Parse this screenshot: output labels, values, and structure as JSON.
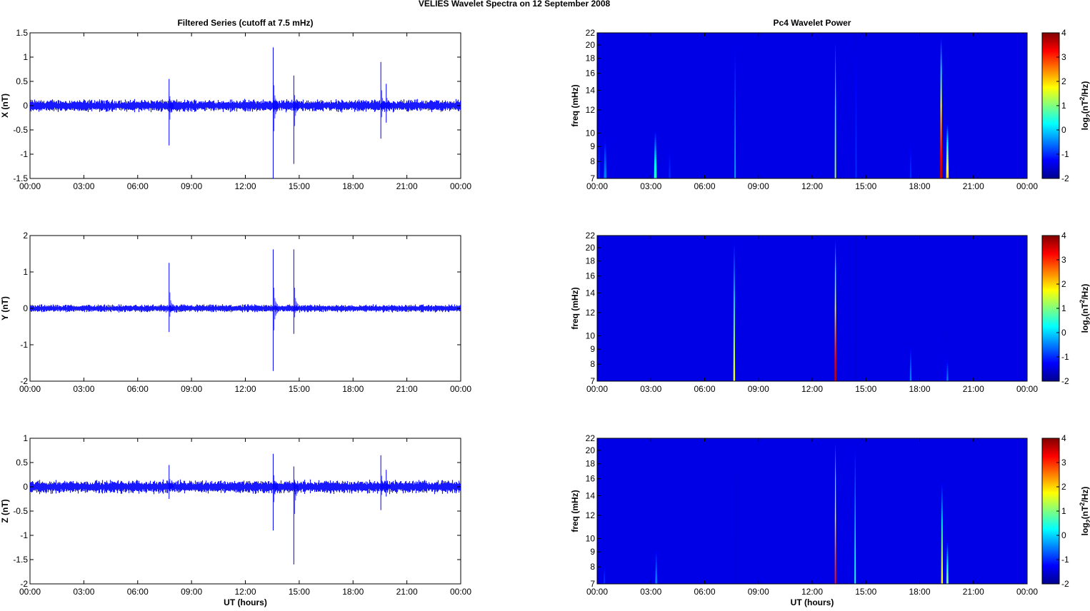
{
  "figure_title": "VELIES Wavelet Spectra on 12 September 2008",
  "chart_data": [
    {
      "type": "line",
      "title": "Filtered Series (cutoff at 7.5 mHz)",
      "ylabel": "X (nT)",
      "xlabel": "",
      "xlim": [
        0,
        24
      ],
      "xticks": [
        "00:00",
        "03:00",
        "06:00",
        "09:00",
        "12:00",
        "15:00",
        "18:00",
        "21:00",
        "00:00"
      ],
      "ylim": [
        -1.5,
        1.5
      ],
      "yticks": [
        "-1.5",
        "-1",
        "-0.5",
        "0",
        "0.5",
        "1",
        "1.5"
      ],
      "noise_amplitude": 0.12,
      "spikes": [
        {
          "t": 7.75,
          "max": 0.55,
          "min": -0.82
        },
        {
          "t": 13.55,
          "max": 1.2,
          "min": -1.5
        },
        {
          "t": 14.7,
          "max": 0.62,
          "min": -1.2
        },
        {
          "t": 19.55,
          "max": 0.9,
          "min": -0.68
        },
        {
          "t": 19.85,
          "max": 0.45,
          "min": -0.35
        }
      ],
      "color": "#0000ff"
    },
    {
      "type": "line",
      "title": "",
      "ylabel": "Y (nT)",
      "xlabel": "",
      "xlim": [
        0,
        24
      ],
      "xticks": [
        "00:00",
        "03:00",
        "06:00",
        "09:00",
        "12:00",
        "15:00",
        "18:00",
        "21:00",
        "00:00"
      ],
      "ylim": [
        -2,
        2
      ],
      "yticks": [
        "-2",
        "-1",
        "0",
        "1",
        "2"
      ],
      "noise_amplitude": 0.1,
      "spikes": [
        {
          "t": 7.75,
          "max": 1.25,
          "min": -0.65
        },
        {
          "t": 13.55,
          "max": 1.62,
          "min": -1.72
        },
        {
          "t": 14.7,
          "max": 1.62,
          "min": -0.7
        }
      ],
      "color": "#0000ff"
    },
    {
      "type": "line",
      "title": "",
      "ylabel": "Z (nT)",
      "xlabel": "UT (hours)",
      "xlim": [
        0,
        24
      ],
      "xticks": [
        "00:00",
        "03:00",
        "06:00",
        "09:00",
        "12:00",
        "15:00",
        "18:00",
        "21:00",
        "00:00"
      ],
      "ylim": [
        -2,
        1
      ],
      "yticks": [
        "-2",
        "-1.5",
        "-1",
        "-0.5",
        "0",
        "0.5",
        "1"
      ],
      "noise_amplitude": 0.13,
      "spikes": [
        {
          "t": 7.75,
          "max": 0.45,
          "min": -0.25
        },
        {
          "t": 13.55,
          "max": 0.68,
          "min": -0.9
        },
        {
          "t": 14.7,
          "max": 0.42,
          "min": -1.6
        },
        {
          "t": 19.55,
          "max": 0.65,
          "min": -0.48
        },
        {
          "t": 19.85,
          "max": 0.35,
          "min": -0.2
        }
      ],
      "color": "#0000ff"
    },
    {
      "type": "heatmap",
      "title": "Pc4 Wavelet Power",
      "ylabel": "freq (mHz)",
      "xlabel": "",
      "xlim": [
        0,
        24
      ],
      "xticks": [
        "00:00",
        "03:00",
        "06:00",
        "09:00",
        "12:00",
        "15:00",
        "18:00",
        "21:00",
        "00:00"
      ],
      "ylim": [
        7,
        22
      ],
      "yscale": "log",
      "yticks": [
        "7",
        "8",
        "9",
        "10",
        "12",
        "14",
        "16",
        "18",
        "20",
        "22"
      ],
      "colorbar": {
        "label": "log2(nT^2/Hz)",
        "label_main": "log",
        "label_sub": "2",
        "label_rest": "(nT",
        "label_sup": "2",
        "label_end": "/Hz)",
        "range": [
          -2,
          4
        ],
        "ticks": [
          "-2",
          "-1",
          "0",
          "1",
          "2",
          "3",
          "4"
        ],
        "colormap": "jet"
      },
      "events": [
        {
          "t": 0.1,
          "fmax": 11.5,
          "power": -1,
          "width": 0.12
        },
        {
          "t": 0.45,
          "fmax": 10,
          "power": -0.5,
          "width": 0.15
        },
        {
          "t": 3.25,
          "fmax": 10.5,
          "power": 0.5,
          "width": 0.15
        },
        {
          "t": 4.05,
          "fmax": 9.5,
          "power": -1,
          "width": 0.1
        },
        {
          "t": 7.7,
          "fmax": 22,
          "power": -0.3,
          "width": 0.06
        },
        {
          "t": 13.3,
          "fmax": 22,
          "power": 1.2,
          "width": 0.07
        },
        {
          "t": 14.45,
          "fmax": 22,
          "power": -1,
          "width": 0.06
        },
        {
          "t": 17.5,
          "fmax": 10,
          "power": -1,
          "width": 0.1
        },
        {
          "t": 19.2,
          "fmax": 22,
          "power": 3.6,
          "width": 0.12
        },
        {
          "t": 19.55,
          "fmax": 11,
          "power": 2,
          "width": 0.15
        }
      ]
    },
    {
      "type": "heatmap",
      "title": "",
      "ylabel": "freq (mHz)",
      "xlabel": "",
      "xlim": [
        0,
        24
      ],
      "xticks": [
        "00:00",
        "03:00",
        "06:00",
        "09:00",
        "12:00",
        "15:00",
        "18:00",
        "21:00",
        "00:00"
      ],
      "ylim": [
        7,
        22
      ],
      "yscale": "log",
      "yticks": [
        "7",
        "8",
        "9",
        "10",
        "12",
        "14",
        "16",
        "18",
        "20",
        "22"
      ],
      "colorbar": {
        "label": "log2(nT^2/Hz)",
        "label_main": "log",
        "label_sub": "2",
        "label_rest": "(nT",
        "label_sup": "2",
        "label_end": "/Hz)",
        "range": [
          -2,
          4
        ],
        "ticks": [
          "-2",
          "-1",
          "0",
          "1",
          "2",
          "3",
          "4"
        ],
        "colormap": "jet"
      },
      "events": [
        {
          "t": 7.65,
          "fmax": 22,
          "power": 1.6,
          "width": 0.1
        },
        {
          "t": 13.3,
          "fmax": 22,
          "power": 3.6,
          "width": 0.1
        },
        {
          "t": 14.45,
          "fmax": 22,
          "power": -1.5,
          "width": 0.05
        },
        {
          "t": 17.5,
          "fmax": 9.5,
          "power": -0.5,
          "width": 0.1
        },
        {
          "t": 19.4,
          "fmax": 10.5,
          "power": -1.3,
          "width": 0.08
        },
        {
          "t": 19.55,
          "fmax": 8.5,
          "power": -0.5,
          "width": 0.1
        }
      ]
    },
    {
      "type": "heatmap",
      "title": "",
      "ylabel": "freq (mHz)",
      "xlabel": "UT (hours)",
      "xlim": [
        0,
        24
      ],
      "xticks": [
        "00:00",
        "03:00",
        "06:00",
        "09:00",
        "12:00",
        "15:00",
        "18:00",
        "21:00",
        "00:00"
      ],
      "ylim": [
        7,
        22
      ],
      "yscale": "log",
      "yticks": [
        "7",
        "8",
        "9",
        "10",
        "12",
        "14",
        "16",
        "18",
        "20",
        "22"
      ],
      "colorbar": {
        "label": "log2(nT^2/Hz)",
        "label_main": "log",
        "label_sub": "2",
        "label_rest": "(nT",
        "label_sup": "2",
        "label_end": "/Hz)",
        "range": [
          -2,
          4
        ],
        "ticks": [
          "-2",
          "-1",
          "0",
          "1",
          "2",
          "3",
          "4"
        ],
        "colormap": "jet"
      },
      "events": [
        {
          "t": 0.4,
          "fmax": 8.5,
          "power": -1,
          "width": 0.1
        },
        {
          "t": 3.3,
          "fmax": 9.5,
          "power": -0.5,
          "width": 0.12
        },
        {
          "t": 7.75,
          "fmax": 17,
          "power": -1.5,
          "width": 0.06
        },
        {
          "t": 13.3,
          "fmax": 22,
          "power": 3.2,
          "width": 0.08
        },
        {
          "t": 14.4,
          "fmax": 22,
          "power": 0.4,
          "width": 0.07
        },
        {
          "t": 19.25,
          "fmax": 16,
          "power": 1.8,
          "width": 0.1
        },
        {
          "t": 19.55,
          "fmax": 10,
          "power": 1,
          "width": 0.12
        }
      ]
    }
  ]
}
